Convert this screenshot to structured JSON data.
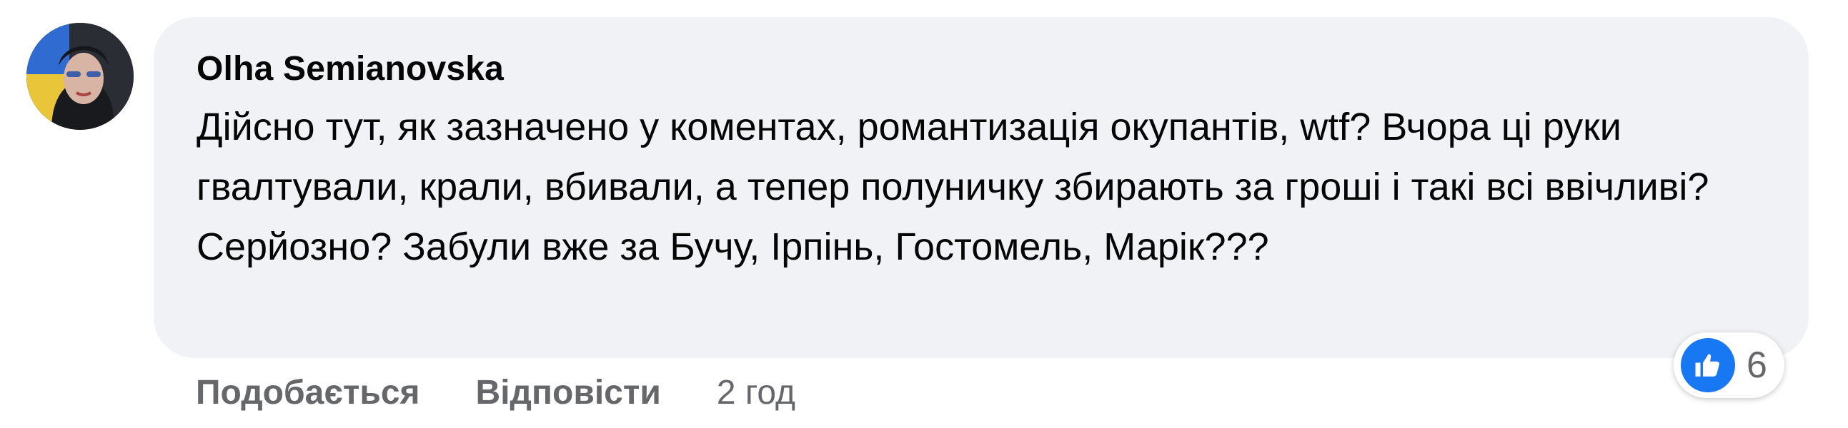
{
  "comment": {
    "author": "Olha Semianovska",
    "text": "Дійсно тут, як зазначено у коментах, романтизація окупантів, wtf? Вчора ці руки гвалтували, крали, вбивали, а тепер полуничку збирають за гроші і такі всі ввічливі? Серйозно? Забули вже за Бучу, Ірпінь, Гостомель, Марік???",
    "like_label": "Подобається",
    "reply_label": "Відповісти",
    "time": "2 год",
    "reactions": {
      "icon": "like-icon",
      "count": "6",
      "accent": "#1877f2"
    }
  },
  "colors": {
    "bubble": "#f0f2f5",
    "text": "#050505",
    "secondary": "#65676b"
  }
}
